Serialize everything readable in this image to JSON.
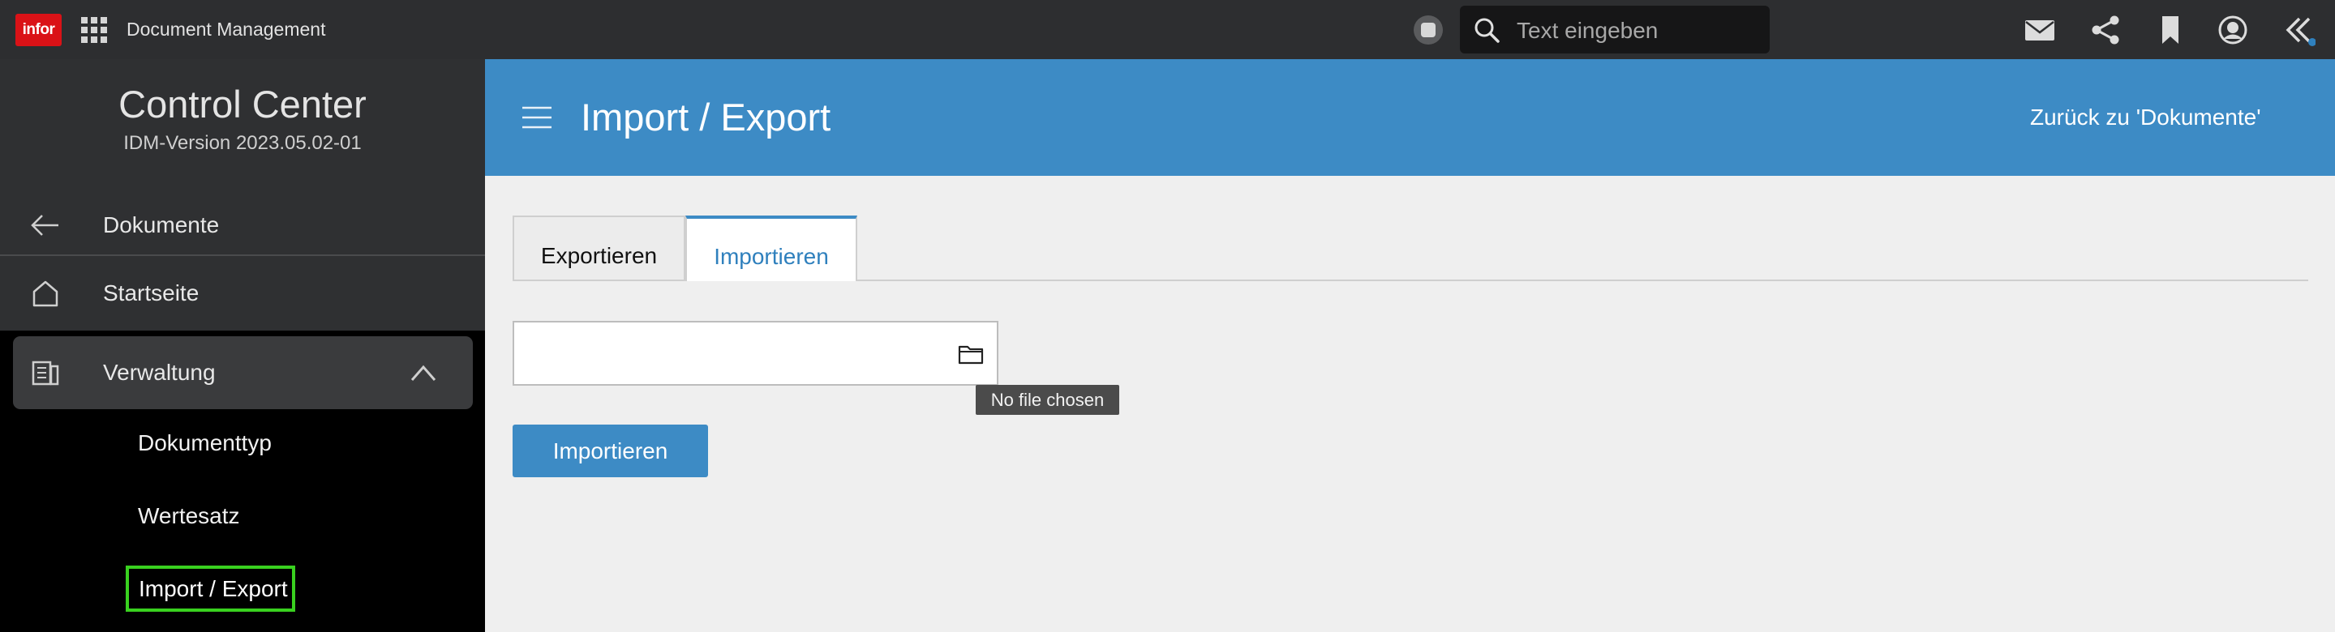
{
  "topbar": {
    "logo_text": "infor",
    "app_title": "Document Management",
    "search_placeholder": "Text eingeben",
    "icons": [
      "apps-grid-icon",
      "square-stop-icon",
      "search-icon",
      "mail-icon",
      "share-icon",
      "bookmark-icon",
      "user-avatar-icon",
      "double-chevron-left-icon"
    ],
    "notification_dot_color": "#2f80bd"
  },
  "sidebar": {
    "title": "Control Center",
    "version": "IDM-Version 2023.05.02-01",
    "items": [
      {
        "label": "Dokumente",
        "icon": "arrow-left-icon"
      },
      {
        "label": "Startseite",
        "icon": "home-icon"
      },
      {
        "label": "Verwaltung",
        "icon": "admin-icon",
        "expanded": true
      }
    ],
    "sub_items": [
      {
        "label": "Dokumenttyp"
      },
      {
        "label": "Wertesatz"
      },
      {
        "label": "Import / Export",
        "selected": true
      }
    ]
  },
  "header": {
    "title": "Import / Export",
    "back_link": "Zurück zu 'Dokumente'"
  },
  "tabs": [
    {
      "label": "Exportieren",
      "active": false
    },
    {
      "label": "Importieren",
      "active": true
    }
  ],
  "import_form": {
    "file_value": "",
    "tooltip": "No file chosen",
    "button_label": "Importieren"
  },
  "colors": {
    "topbar_bg": "#2d2e30",
    "header_bg": "#3d8bc5",
    "accent": "#2f80bd",
    "logo_red": "#da1217",
    "selected_outline": "#39d11f"
  }
}
